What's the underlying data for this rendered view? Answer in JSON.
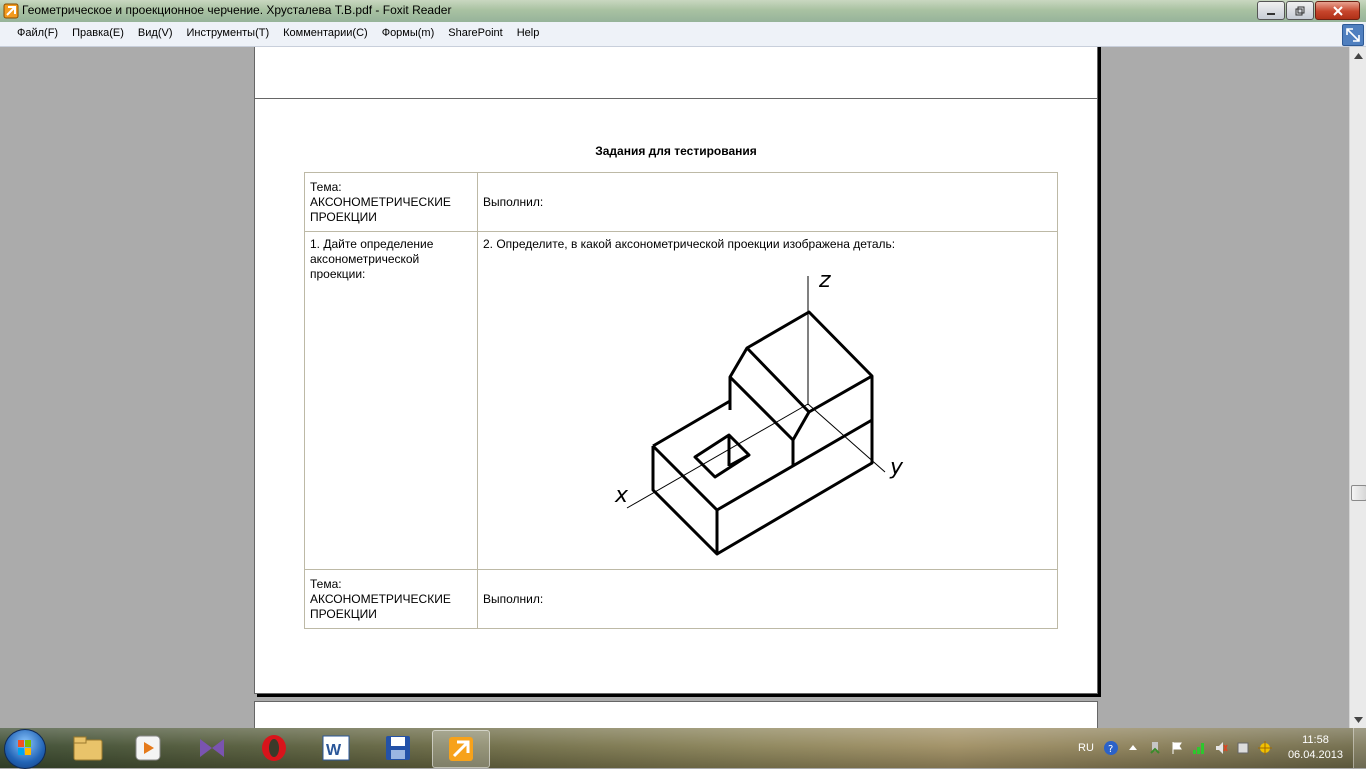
{
  "window": {
    "title": "Геометрическое и проекционное черчение. Хрусталева Т.В.pdf - Foxit Reader",
    "controls": [
      "minimize",
      "maximize",
      "close"
    ]
  },
  "menu": {
    "items": [
      "Файл(F)",
      "Правка(E)",
      "Вид(V)",
      "Инструменты(T)",
      "Комментарии(C)",
      "Формы(m)",
      "SharePoint",
      "Help"
    ]
  },
  "page": {
    "heading": "Задания для тестирования",
    "rows": {
      "r1": {
        "c1": [
          "Тема:",
          "АКСОНОМЕТРИЧЕСКИЕ",
          "ПРОЕКЦИИ"
        ],
        "c2": "Выполнил:"
      },
      "r2": {
        "c1": [
          "1. Дайте определение",
          "аксонометрической",
          "проекции:"
        ],
        "c2": "2. Определите, в какой аксонометрической проекции изображена деталь:"
      },
      "r3": {
        "c1": [
          "Тема:",
          "АКСОНОМЕТРИЧЕСКИЕ",
          "ПРОЕКЦИИ"
        ],
        "c2": "Выполнил:"
      }
    },
    "figure": {
      "axis_x": "x",
      "axis_y": "y",
      "axis_z": "z"
    }
  },
  "taskbar": {
    "apps": [
      "windows-explorer",
      "media-player",
      "visual-studio",
      "opera",
      "microsoft-word",
      "save-app",
      "foxit-reader"
    ],
    "active_app": "foxit-reader",
    "language": "RU",
    "time": "11:58",
    "date": "06.04.2013"
  },
  "colors": {
    "page_bg": "#ffffff",
    "doc_bg": "#ababab",
    "table_border": "#bdb9a6",
    "menu_bg": "#eef2f8"
  }
}
